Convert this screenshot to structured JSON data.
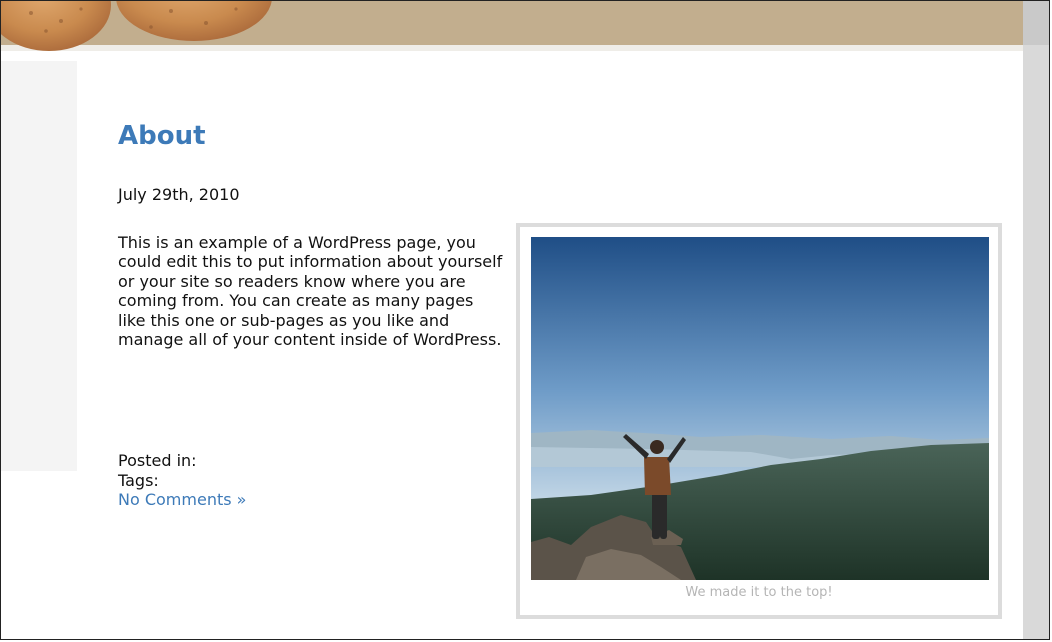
{
  "page": {
    "title": "About",
    "date": "July 29th, 2010",
    "body": "This is an example of a WordPress page, you could edit this to put information about yourself or your site so readers know where you are coming from. You can create as many pages like this one or sub-pages as you like and manage all of your content inside of WordPress.",
    "posted_in_label": "Posted in:",
    "tags_label": "Tags:",
    "comments_link": "No Comments »"
  },
  "image": {
    "caption": "We made it to the top!"
  },
  "colors": {
    "accent": "#3d7ab8",
    "header_band": "#c2ae8e",
    "caption": "#b5b5b5"
  }
}
